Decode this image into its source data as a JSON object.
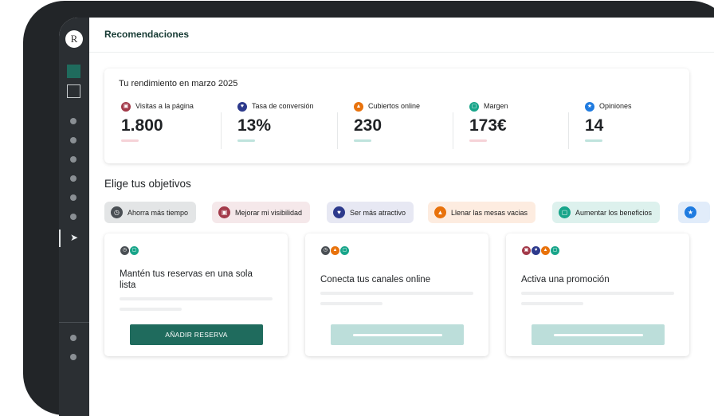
{
  "app": {
    "logo_letter": "R",
    "page_title": "Recomendaciones"
  },
  "sidebar": {
    "active_icon": "rocket-icon"
  },
  "performance": {
    "title": "Tu rendimiento en marzo 2025",
    "metrics": [
      {
        "label": "Visitas a la página",
        "value": "1.800",
        "icon": "laptop-icon",
        "color": "#a33a4a",
        "bar_color": "#f6d3d8"
      },
      {
        "label": "Tasa de conversión",
        "value": "13%",
        "icon": "heart-icon",
        "color": "#2d3a8c",
        "bar_color": "#bfe3dd"
      },
      {
        "label": "Cubiertos online",
        "value": "230",
        "icon": "cloche-icon",
        "color": "#e8720c",
        "bar_color": "#bfe3dd"
      },
      {
        "label": "Margen",
        "value": "173€",
        "icon": "wallet-icon",
        "color": "#18a58a",
        "bar_color": "#f6d3d8"
      },
      {
        "label": "Opiniones",
        "value": "14",
        "icon": "star-icon",
        "color": "#1f7be0",
        "bar_color": "#bfe3dd"
      }
    ]
  },
  "goals": {
    "title": "Elige tus objetivos",
    "chips": [
      {
        "label": "Ahorra más tiempo",
        "icon": "clock-icon",
        "bg": "#e3e5e6",
        "icon_color": "#4a4f54"
      },
      {
        "label": "Mejorar mi visibilidad",
        "icon": "laptop-icon",
        "bg": "#f5e8ea",
        "icon_color": "#a33a4a"
      },
      {
        "label": "Ser más atractivo",
        "icon": "heart-icon",
        "bg": "#e7e8f3",
        "icon_color": "#2d3a8c"
      },
      {
        "label": "Llenar las mesas vacias",
        "icon": "cloche-icon",
        "bg": "#fdece0",
        "icon_color": "#e8720c"
      },
      {
        "label": "Aumentar los  beneficios",
        "icon": "wallet-icon",
        "bg": "#ddf1ed",
        "icon_color": "#18a58a"
      },
      {
        "label": "",
        "icon": "star-icon",
        "bg": "#e1ecfa",
        "icon_color": "#1f7be0"
      }
    ]
  },
  "cards": [
    {
      "title": "Mantén tus reservas en una sola lista",
      "button_label": "AÑADIR RESERVA",
      "button_color": "#1f6b5d",
      "icons": [
        {
          "name": "clock-icon",
          "color": "#4a4f54"
        },
        {
          "name": "wallet-icon",
          "color": "#18a58a"
        }
      ]
    },
    {
      "title": "Conecta tus canales online",
      "button_label": "",
      "icons": [
        {
          "name": "clock-icon",
          "color": "#4a4f54"
        },
        {
          "name": "cloche-icon",
          "color": "#e8720c"
        },
        {
          "name": "wallet-icon",
          "color": "#18a58a"
        }
      ]
    },
    {
      "title": "Activa una promoción",
      "button_label": "",
      "icons": [
        {
          "name": "laptop-icon",
          "color": "#a33a4a"
        },
        {
          "name": "heart-icon",
          "color": "#2d3a8c"
        },
        {
          "name": "cloche-icon",
          "color": "#e8720c"
        },
        {
          "name": "wallet-icon",
          "color": "#18a58a"
        }
      ]
    }
  ]
}
